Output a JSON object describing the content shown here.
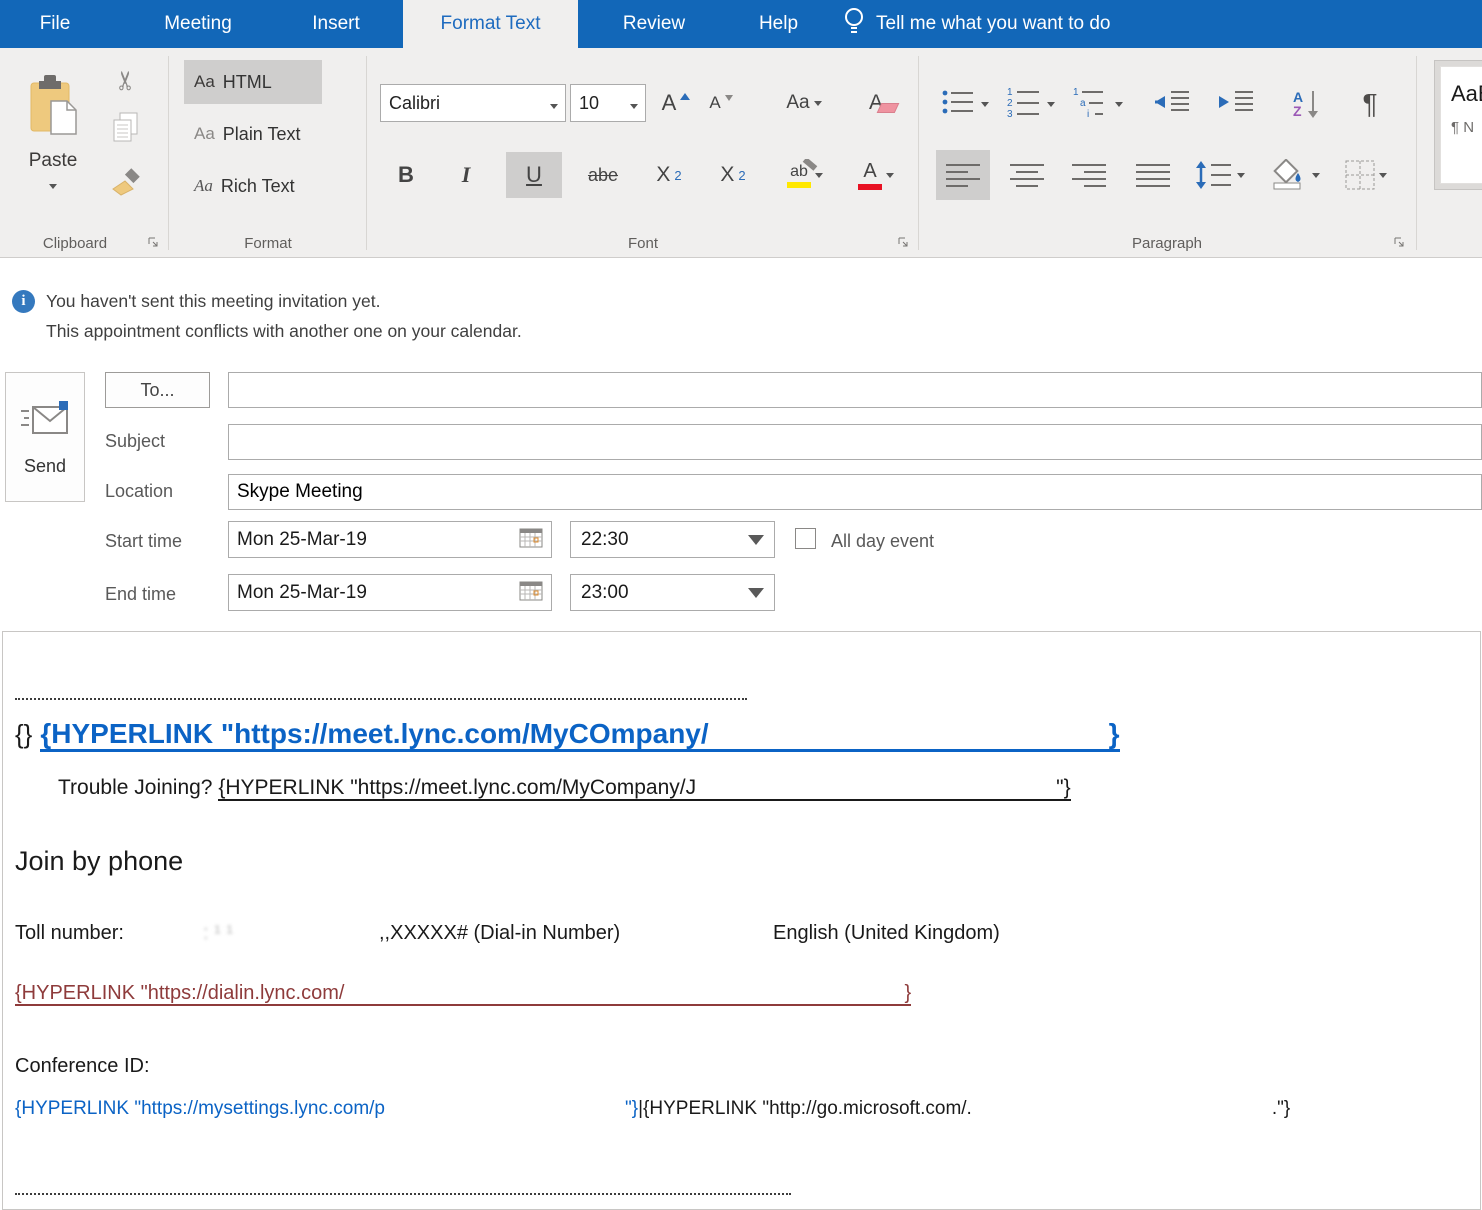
{
  "tabs": [
    {
      "label": "File"
    },
    {
      "label": "Meeting"
    },
    {
      "label": "Insert"
    },
    {
      "label": "Format Text"
    },
    {
      "label": "Review"
    },
    {
      "label": "Help"
    }
  ],
  "tellme": {
    "label": "Tell me what you want to do"
  },
  "ribbon": {
    "clipboard": {
      "group_label": "Clipboard",
      "paste_label": "Paste"
    },
    "format": {
      "group_label": "Format",
      "aa": "Aa",
      "html": "HTML",
      "plain": "Plain Text",
      "rich": "Rich Text"
    },
    "font": {
      "group_label": "Font",
      "font_name": "Calibri",
      "font_size": "10",
      "grow": "A",
      "shrink": "A",
      "change_case": "Aa",
      "clear": "A",
      "bold": "B",
      "italic": "I",
      "underline": "U",
      "strike": "abe",
      "sub_x": "X",
      "sub_2": "2",
      "sup_x": "X",
      "sup_2": "2",
      "highlight": "ab",
      "font_color": "A"
    },
    "paragraph": {
      "group_label": "Paragraph",
      "pilcrow": "¶",
      "sort_a": "A",
      "sort_z": "Z",
      "num1": "1",
      "num2": "2",
      "num3": "3",
      "ml1": "1",
      "ml2": "a",
      "ml3": "i"
    },
    "styles": {
      "preview": "AaB",
      "style_name": "¶ N"
    }
  },
  "infobar": {
    "line1": "You haven't sent this meeting invitation yet.",
    "line2": "This appointment conflicts with another one on your calendar."
  },
  "form": {
    "send_label": "Send",
    "to_button": "To...",
    "subject_label": "Subject",
    "location_label": "Location",
    "location_value": "Skype Meeting",
    "start_label": "Start time",
    "end_label": "End time",
    "start_date": "Mon 25-Mar-19",
    "start_time": "22:30",
    "end_date": "Mon 25-Mar-19",
    "end_time": "23:00",
    "allday_label": "All day event"
  },
  "body": {
    "braces": "{}",
    "join_link_prefix": "{HYPERLINK \"https://meet.lync.com/MyCOmpany/",
    "join_link_close": "}",
    "trouble_label": "Trouble Joining? ",
    "trouble_link_prefix": "{HYPERLINK \"https://meet.lync.com/MyCompany/J",
    "trouble_link_close": "\"}",
    "join_by_phone": "Join by phone",
    "toll_label": "Toll number:",
    "toll_dialin": ",,XXXXX# (Dial-in Number)",
    "toll_language": "English (United Kingdom)",
    "dialin_link_prefix": "{HYPERLINK \"https://dialin.lync.com/",
    "dialin_link_close": "}",
    "conference_label": "Conference ID:",
    "settings_link_prefix": "{HYPERLINK \"https://mysettings.lync.com/p",
    "settings_link_close": "\"}",
    "separator": "|",
    "go_link_prefix": "{HYPERLINK \"http://go.microsoft.com/.",
    "go_link_close": ".\"}"
  },
  "colors": {
    "ribbon_blue": "#1267b8",
    "active_tab_text": "#1e6bbf",
    "link_blue": "#0b63c5",
    "link_maroon": "#8e3b3b",
    "highlight_yellow": "#ffe800",
    "font_color_red": "#e81123",
    "clipboard_tan": "#eec97e"
  }
}
